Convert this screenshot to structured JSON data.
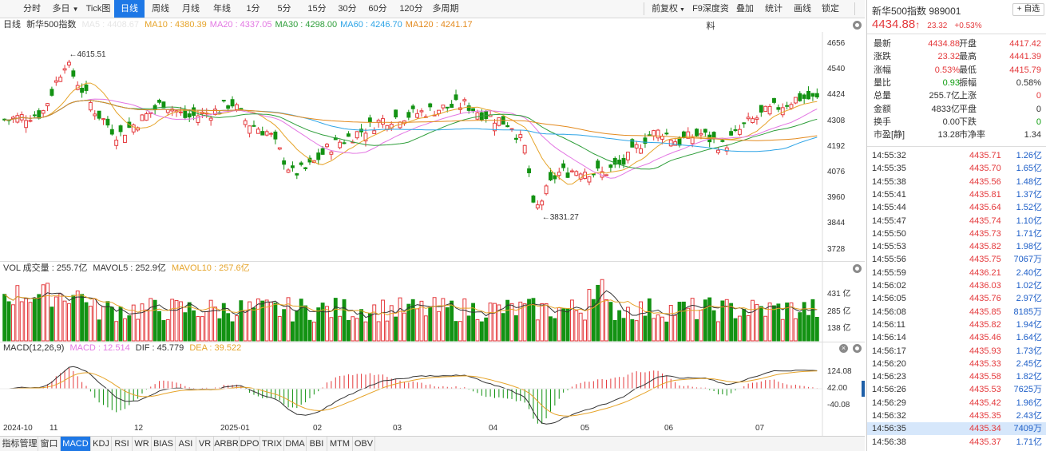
{
  "toolbar": {
    "left": [
      "分时",
      "多日",
      "Tick图",
      "日线",
      "周线",
      "月线",
      "年线",
      "1分",
      "5分",
      "15分",
      "30分",
      "60分",
      "120分",
      "多周期"
    ],
    "active": "日线",
    "right": [
      "前复权",
      "F9深度资料",
      "叠加",
      "统计",
      "画线",
      "锁定"
    ]
  },
  "main": {
    "period": "日线",
    "name": "新华500指数",
    "ma_hidden": "MA5 : 4408.67",
    "ma": [
      {
        "text": "MA10 : 4380.39",
        "color": "#e6a42a"
      },
      {
        "text": "MA20 : 4337.05",
        "color": "#e377e3"
      },
      {
        "text": "MA30 : 4298.00",
        "color": "#2e9e3a"
      },
      {
        "text": "MA60 : 4246.70",
        "color": "#2ea4e6"
      },
      {
        "text": "MA120 : 4241.17",
        "color": "#e38a1e"
      }
    ],
    "y": [
      "4656",
      "4540",
      "4424",
      "4308",
      "4192",
      "4076",
      "3960",
      "3844",
      "3728"
    ],
    "high_label": "←4615.51",
    "low_label": "←3831.27"
  },
  "vol": {
    "title": "VOL 成交量 : 255.7亿",
    "mavol5": "MAVOL5 : 252.9亿",
    "mavol10": "MAVOL10 : 257.6亿",
    "y": [
      "431 亿",
      "285 亿",
      "138 亿"
    ]
  },
  "macd": {
    "title": "MACD(12,26,9)",
    "macd": "MACD : 12.514",
    "dif": "DIF : 45.779",
    "dea": "DEA : 39.522",
    "y": [
      "124.08",
      "42.00",
      "-40.08"
    ]
  },
  "x_labels": [
    "2024-10",
    "11",
    "12",
    "2025-01",
    "02",
    "03",
    "04",
    "05",
    "06",
    "07"
  ],
  "bottom_tabs": [
    "指标管理",
    "窗口",
    "MACD",
    "KDJ",
    "RSI",
    "WR",
    "BIAS",
    "ASI",
    "VR",
    "ARBR",
    "DPO",
    "TRIX",
    "DMA",
    "BBI",
    "MTM",
    "OBV"
  ],
  "bottom_active": "MACD",
  "colors": {
    "up": "#e4393c",
    "down": "#139213",
    "accent": "#1e78e6"
  },
  "quote": {
    "title": "新华500指数",
    "code": "989001",
    "add": "+ 自选",
    "price": "4434.88",
    "arrow": "↑",
    "change": "23.32",
    "pct": "+0.53%",
    "rows": [
      [
        "最新",
        "4434.88",
        "开盘",
        "4417.42"
      ],
      [
        "涨跌",
        "23.32",
        "最高",
        "4441.39"
      ],
      [
        "涨幅",
        "0.53%",
        "最低",
        "4415.79"
      ],
      [
        "量比",
        "0.93",
        "振幅",
        "0.58%"
      ],
      [
        "总量",
        "255.7亿",
        "上涨",
        "0"
      ],
      [
        "金额",
        "4833亿",
        "平盘",
        "0"
      ],
      [
        "换手",
        "0.00",
        "下跌",
        "0"
      ],
      [
        "市盈[静]",
        "13.28",
        "市净率",
        "1.34"
      ]
    ]
  },
  "trades": [
    [
      "14:55:32",
      "4435.71",
      "1.26亿"
    ],
    [
      "14:55:35",
      "4435.70",
      "1.65亿"
    ],
    [
      "14:55:38",
      "4435.56",
      "1.48亿"
    ],
    [
      "14:55:41",
      "4435.81",
      "1.37亿"
    ],
    [
      "14:55:44",
      "4435.64",
      "1.52亿"
    ],
    [
      "14:55:47",
      "4435.74",
      "1.10亿"
    ],
    [
      "14:55:50",
      "4435.73",
      "1.71亿"
    ],
    [
      "14:55:53",
      "4435.82",
      "1.98亿"
    ],
    [
      "14:55:56",
      "4435.75",
      "7067万"
    ],
    [
      "14:55:59",
      "4436.21",
      "2.40亿"
    ],
    [
      "14:56:02",
      "4436.03",
      "1.02亿"
    ],
    [
      "14:56:05",
      "4435.76",
      "2.97亿"
    ],
    [
      "14:56:08",
      "4435.85",
      "8185万"
    ],
    [
      "14:56:11",
      "4435.82",
      "1.94亿"
    ],
    [
      "14:56:14",
      "4435.46",
      "1.64亿"
    ],
    [
      "14:56:17",
      "4435.93",
      "1.73亿"
    ],
    [
      "14:56:20",
      "4435.33",
      "2.45亿"
    ],
    [
      "14:56:23",
      "4435.58",
      "1.82亿"
    ],
    [
      "14:56:26",
      "4435.53",
      "7625万"
    ],
    [
      "14:56:29",
      "4435.42",
      "1.96亿"
    ],
    [
      "14:56:32",
      "4435.35",
      "2.43亿"
    ],
    [
      "14:56:35",
      "4435.34",
      "7409万"
    ],
    [
      "14:56:38",
      "4435.37",
      "1.71亿"
    ]
  ],
  "trade_highlight": 21
}
